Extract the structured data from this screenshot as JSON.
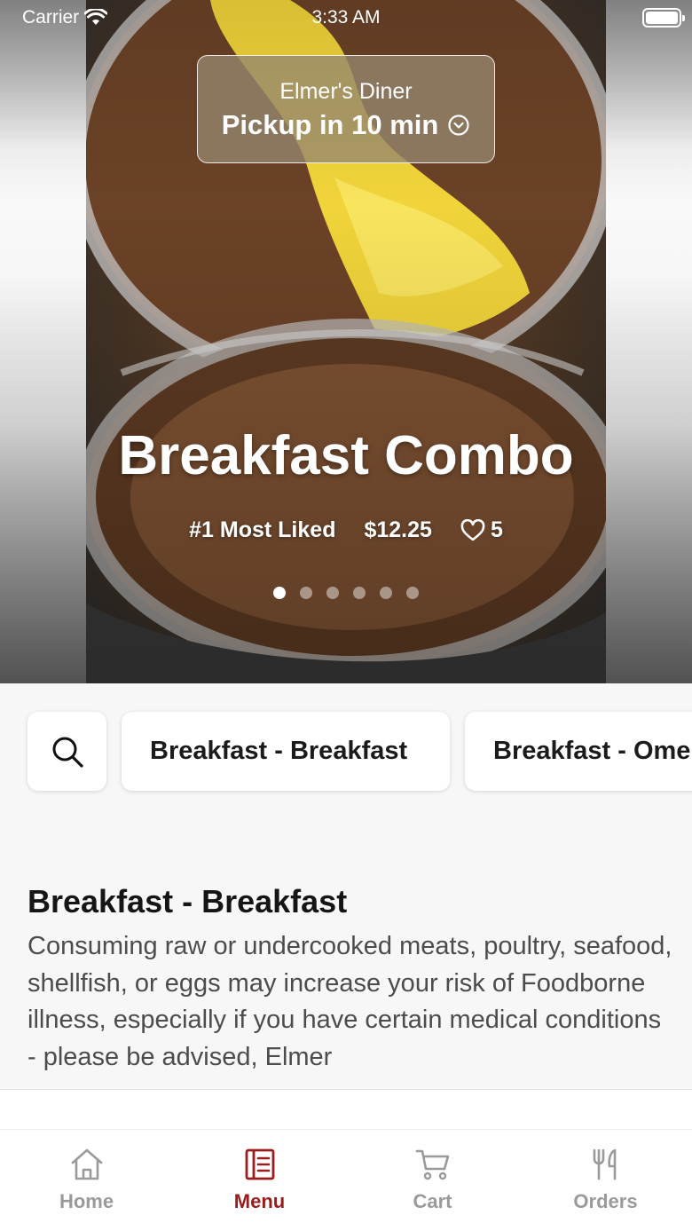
{
  "status_bar": {
    "carrier": "Carrier",
    "time": "3:33 AM"
  },
  "header": {
    "store_name": "Elmer's Diner",
    "pickup_label": "Pickup in 10 min"
  },
  "featured": {
    "title": "Breakfast Combo",
    "rank": "#1 Most Liked",
    "price": "$12.25",
    "likes": "5",
    "carousel_total": 6,
    "carousel_active": 1
  },
  "categories": {
    "search_icon": "search-icon",
    "items": [
      {
        "label": "Breakfast - Breakfast"
      },
      {
        "label": "Breakfast - Ome"
      }
    ]
  },
  "section": {
    "title": "Breakfast - Breakfast",
    "description": "Consuming raw or undercooked meats, poultry, seafood, shellfish, or eggs may increase your risk of Foodborne illness, especially if you have certain medical conditions - please be advised, Elmer"
  },
  "tab_bar": {
    "items": [
      {
        "label": "Home",
        "icon": "home-icon"
      },
      {
        "label": "Menu",
        "icon": "menu-icon",
        "active": true
      },
      {
        "label": "Cart",
        "icon": "cart-icon"
      },
      {
        "label": "Orders",
        "icon": "fork-knife-icon"
      }
    ]
  },
  "colors": {
    "accent": "#9a1c1c",
    "inactive": "#9a9a9a",
    "background": "#f7f7f7"
  }
}
